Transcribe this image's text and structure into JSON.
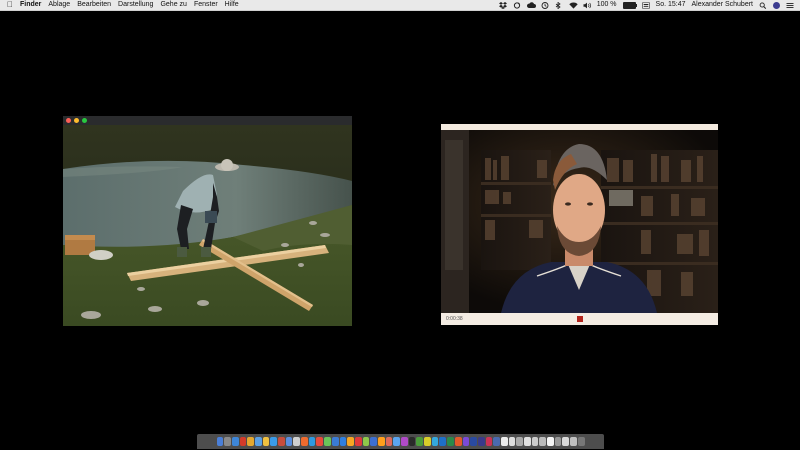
{
  "menubar": {
    "app_name": "Finder",
    "items": [
      "Ablage",
      "Bearbeiten",
      "Darstellung",
      "Gehe zu",
      "Fenster",
      "Hilfe"
    ],
    "battery_text": "100 %",
    "battery_level": 1.0,
    "clock": "So. 15:47",
    "user": "Alexander Schubert",
    "status_icons": [
      "dropbox-icon",
      "sync-icon",
      "cloud-icon",
      "time-machine-icon",
      "bluetooth-icon",
      "wifi-icon",
      "volume-icon",
      "keyboard-icon"
    ]
  },
  "photo_window": {
    "scene_description_icon": "photo-image"
  },
  "video_window": {
    "timecode": "0:00:38"
  },
  "dock": {
    "icons": [
      "#4a7fd8",
      "#8a8a8a",
      "#3d86d8",
      "#d33b2a",
      "#e5a830",
      "#5aa0e6",
      "#f0c040",
      "#3a9be8",
      "#c84d3c",
      "#5a8fe0",
      "#d0d0d0",
      "#ef6b2e",
      "#2e9ae0",
      "#e94b3c",
      "#6ac55a",
      "#3a7bd5",
      "#2f7fe0",
      "#f6a623",
      "#e03a3a",
      "#8ec84a",
      "#3d6fd0",
      "#ff9f1c",
      "#e06a5a",
      "#5aa5f0",
      "#b04ac8",
      "#2a2a2a",
      "#4a9c3a",
      "#d8ce2a",
      "#34a8dc",
      "#1f6fc8",
      "#2a8a4a",
      "#e45a2a",
      "#7a4ad8",
      "#2a4aa0",
      "#3a3a8a",
      "#cc3355",
      "#4a6ab0",
      "#eeeeee",
      "#dddddd",
      "#aaaaaa",
      "#e0e0e0",
      "#cccccc",
      "#bbbbbb",
      "#f5f5f5",
      "#999999",
      "#dadada",
      "#c0c0c0",
      "#777777"
    ]
  }
}
